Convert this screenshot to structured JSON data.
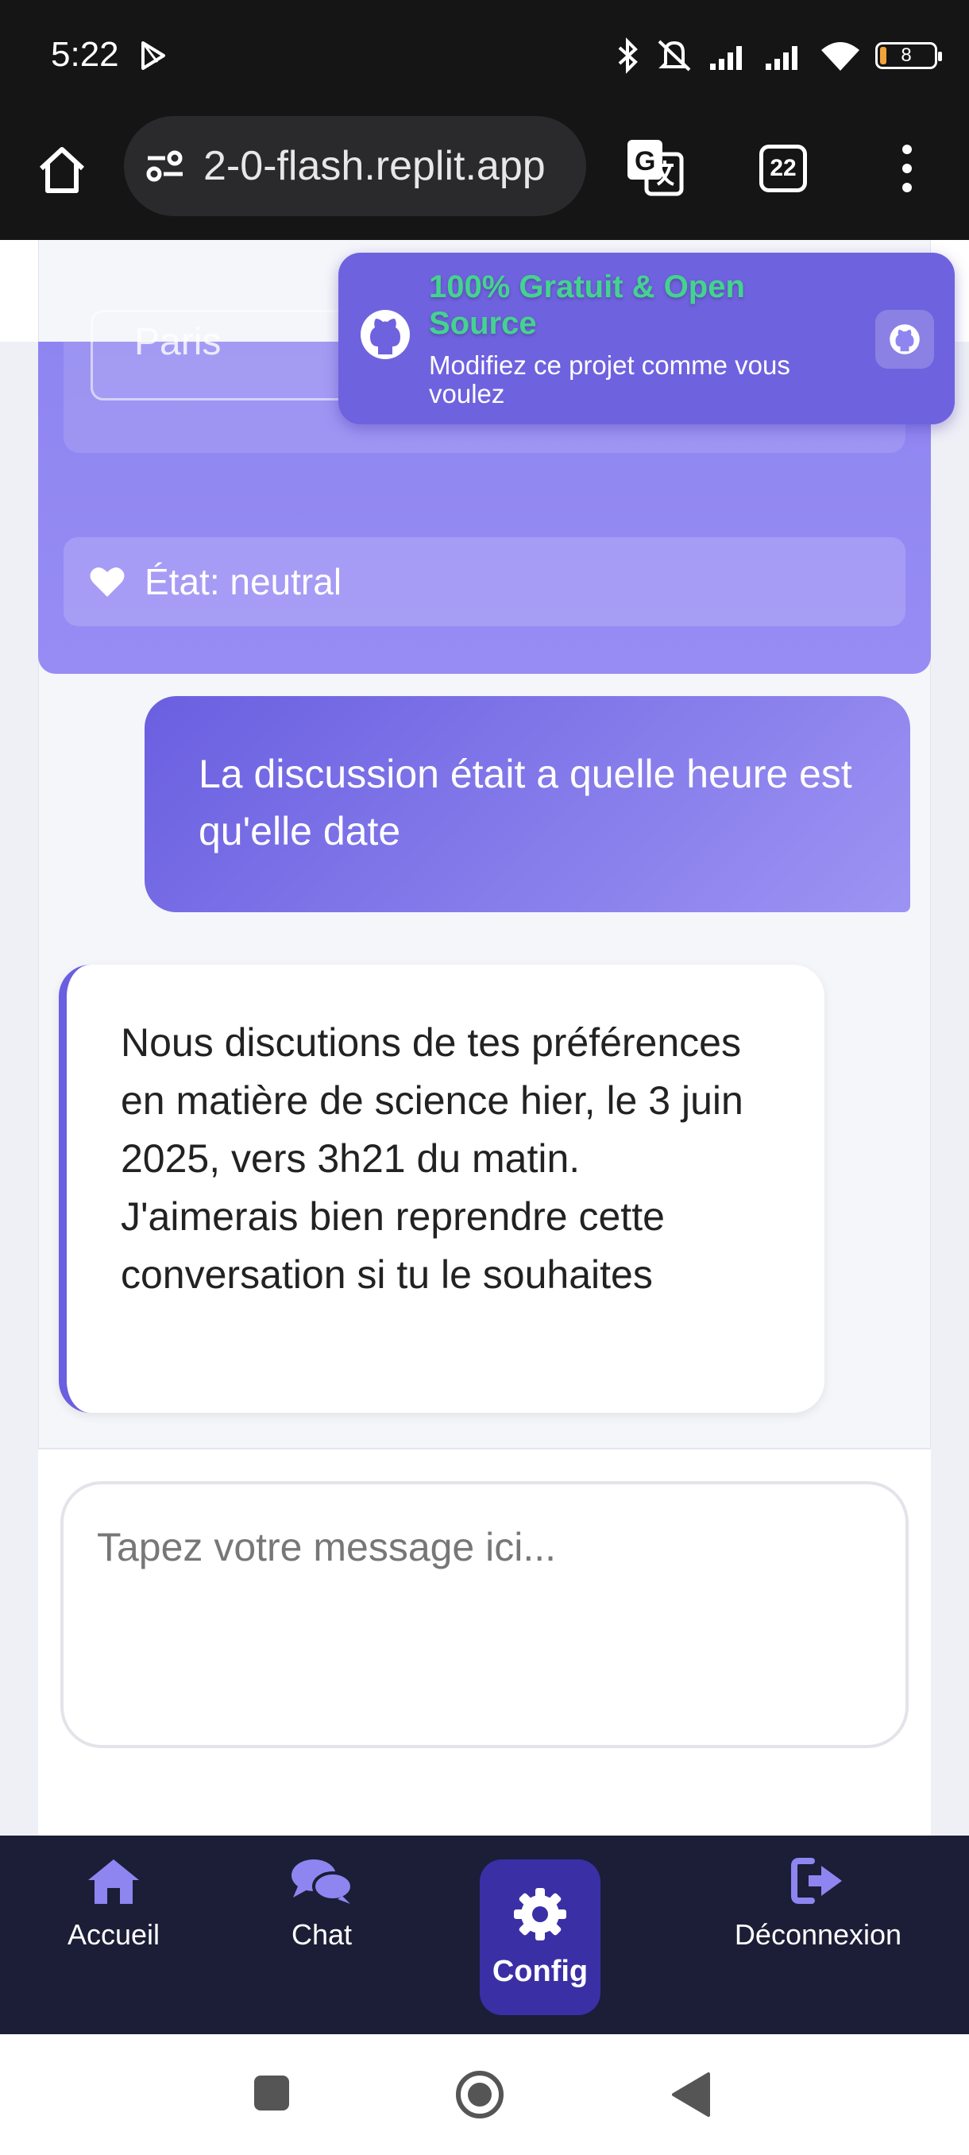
{
  "status": {
    "time": "5:22",
    "battery": "8"
  },
  "browser": {
    "url": "2-0-flash.replit.app",
    "tab_count": "22"
  },
  "banner": {
    "title": "100% Gratuit & Open Source",
    "subtitle": "Modifiez ce projet comme vous voulez",
    "title_color": "#44d38f"
  },
  "profile": {
    "city_value": "Paris",
    "state_label": "État: neutral"
  },
  "messages": [
    {
      "role": "user",
      "text": "La discussion était a quelle heure est qu'elle date"
    },
    {
      "role": "assistant",
      "text": "Nous discutions de tes préférences en matière de science hier, le 3 juin 2025, vers 3h21 du matin. J'aimerais bien reprendre cette conversation si tu le souhaites"
    }
  ],
  "composer": {
    "placeholder": "Tapez votre message ici..."
  },
  "nav": {
    "home": "Accueil",
    "chat": "Chat",
    "config": "Config",
    "logout": "Déconnexion",
    "active_color": "#3b2fa6",
    "icon_color": "#8f85f1"
  }
}
